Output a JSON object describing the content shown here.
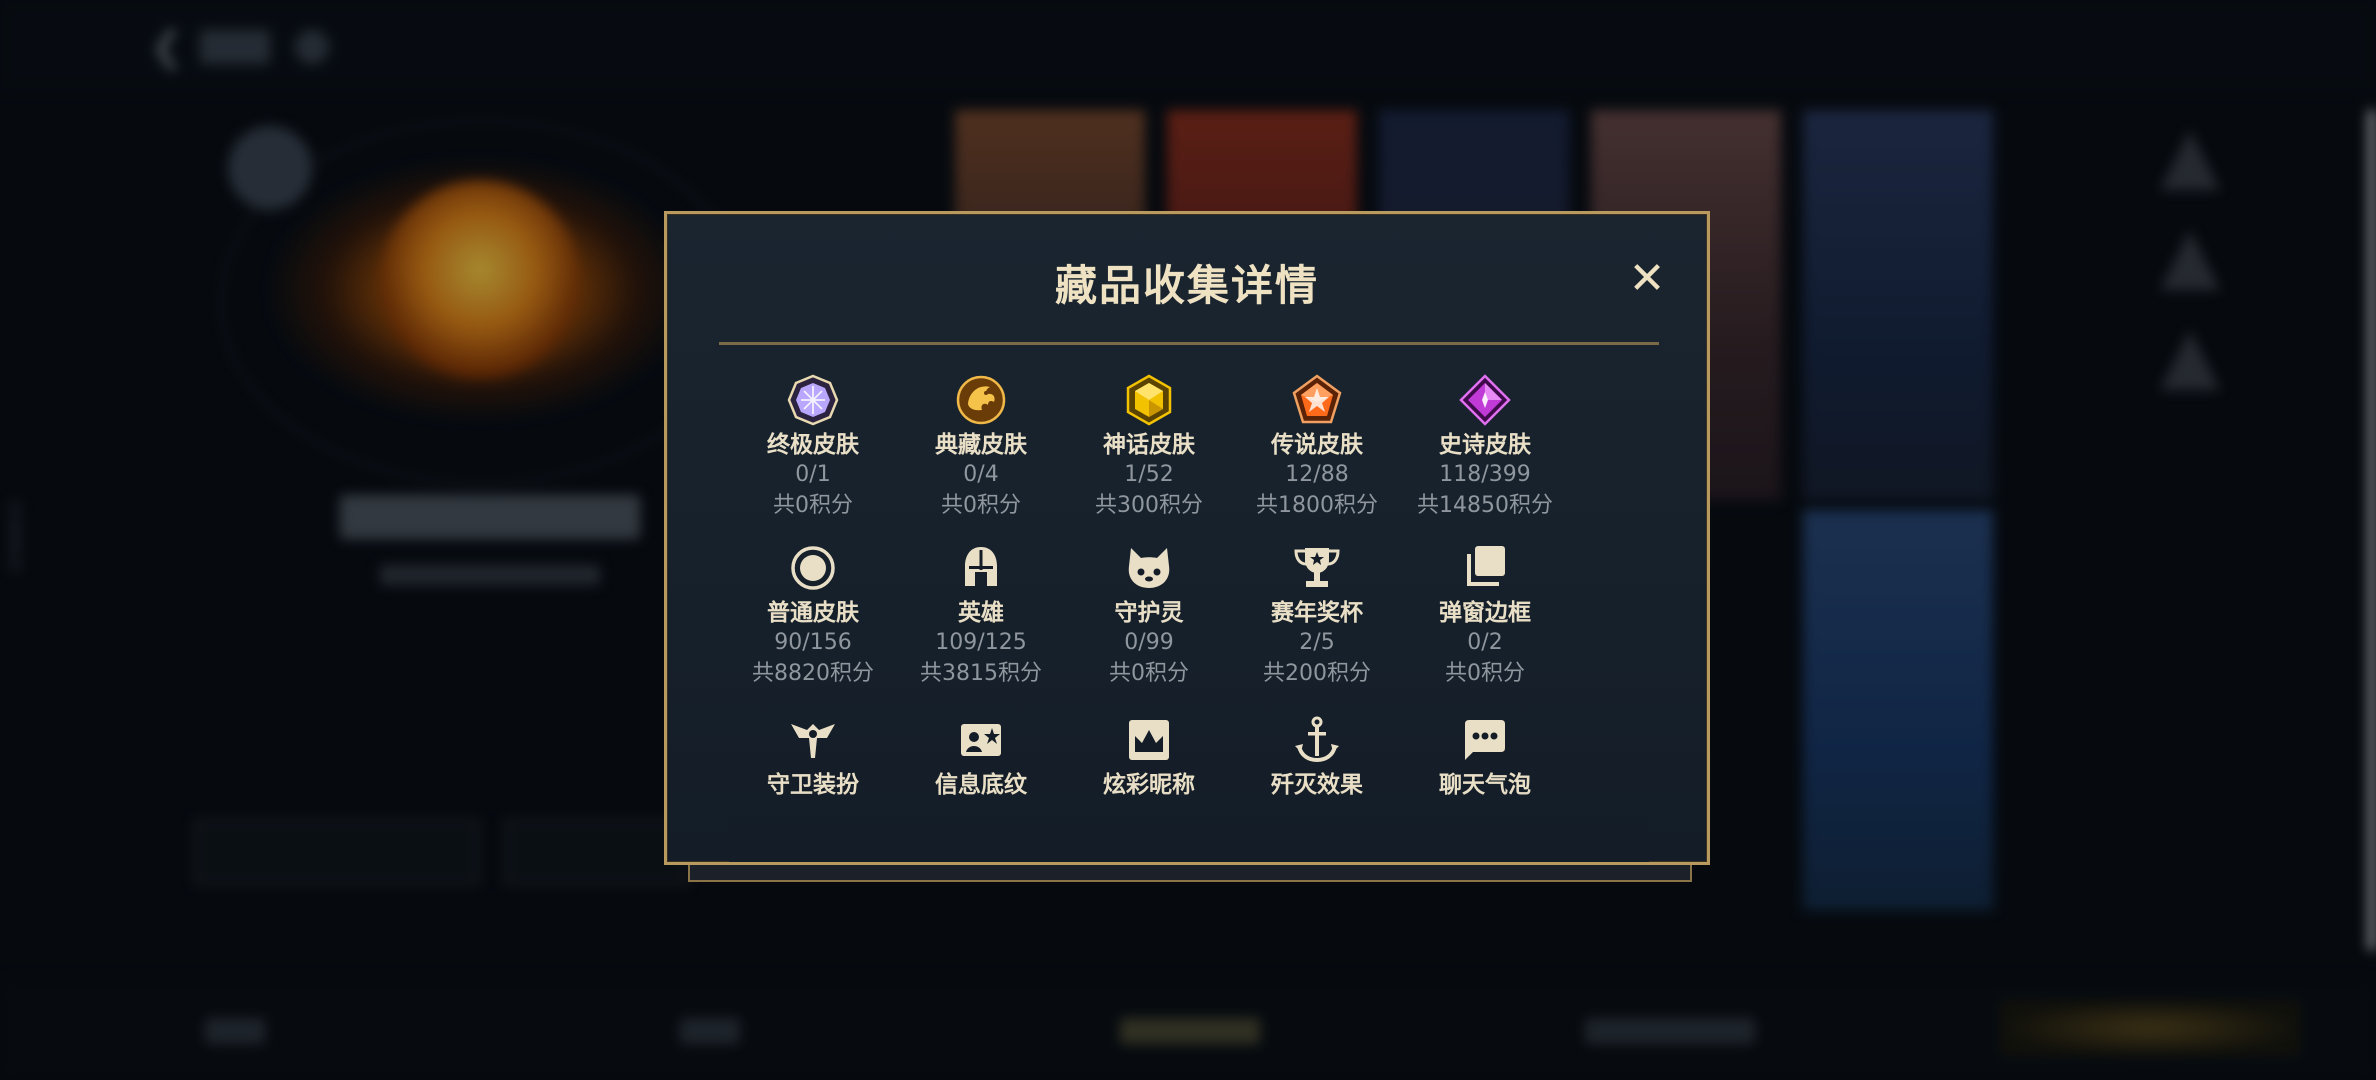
{
  "modal": {
    "title": "藏品收集详情",
    "close_symbol": "✕",
    "categories": [
      {
        "name": "终极皮肤",
        "progress": "0/1",
        "points": "共0积分",
        "icon": "ultimate-skin-gem-icon",
        "color": "#b9a6ff"
      },
      {
        "name": "典藏皮肤",
        "progress": "0/4",
        "points": "共0积分",
        "icon": "collection-skin-dragon-icon",
        "color": "#e0a030"
      },
      {
        "name": "神话皮肤",
        "progress": "1/52",
        "points": "共300积分",
        "icon": "myth-skin-gem-icon",
        "color": "#f2c200"
      },
      {
        "name": "传说皮肤",
        "progress": "12/88",
        "points": "共1800积分",
        "icon": "legend-skin-gem-icon",
        "color": "#ff6a1a"
      },
      {
        "name": "史诗皮肤",
        "progress": "118/399",
        "points": "共14850积分",
        "icon": "epic-skin-gem-icon",
        "color": "#c03ad8"
      },
      {
        "name": "普通皮肤",
        "progress": "90/156",
        "points": "共8820积分",
        "icon": "normal-skin-circle-icon",
        "color": "#e9dfc7"
      },
      {
        "name": "英雄",
        "progress": "109/125",
        "points": "共3815积分",
        "icon": "hero-helmet-icon",
        "color": "#e9dfc7"
      },
      {
        "name": "守护灵",
        "progress": "0/99",
        "points": "共0积分",
        "icon": "guardian-spirit-icon",
        "color": "#e9dfc7"
      },
      {
        "name": "赛年奖杯",
        "progress": "2/5",
        "points": "共200积分",
        "icon": "season-trophy-icon",
        "color": "#e9dfc7"
      },
      {
        "name": "弹窗边框",
        "progress": "0/2",
        "points": "共0积分",
        "icon": "popup-frame-icon",
        "color": "#e9dfc7"
      },
      {
        "name": "守卫装扮",
        "icon": "guard-outfit-icon",
        "color": "#e9dfc7"
      },
      {
        "name": "信息底纹",
        "icon": "info-background-icon",
        "color": "#e9dfc7"
      },
      {
        "name": "炫彩昵称",
        "icon": "colorful-nickname-icon",
        "color": "#e9dfc7"
      },
      {
        "name": "歼灭效果",
        "icon": "annihilation-effect-icon",
        "color": "#e9dfc7"
      },
      {
        "name": "聊天气泡",
        "icon": "chat-bubble-icon",
        "color": "#e9dfc7"
      }
    ]
  },
  "background": {
    "side_id": "43369019"
  }
}
